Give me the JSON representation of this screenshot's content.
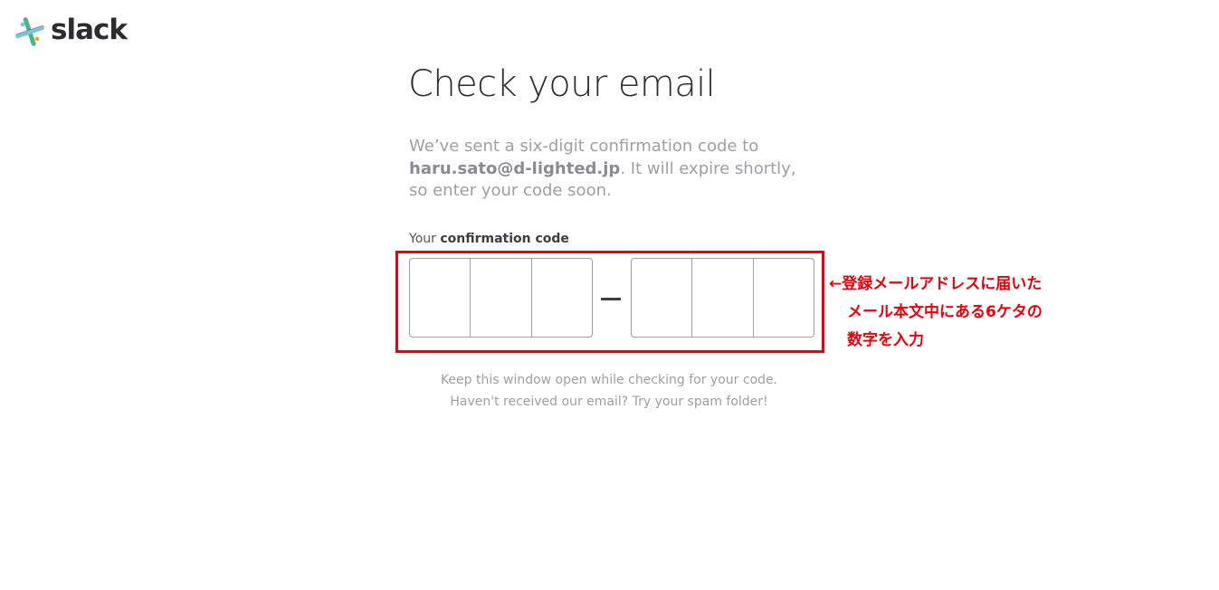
{
  "brand": {
    "name": "slack",
    "colors": {
      "blue": "#70cadb",
      "green": "#3eb890",
      "red": "#e01765",
      "yellow": "#e9a820"
    }
  },
  "page": {
    "title": "Check your email",
    "description": {
      "before_email": "We’ve sent a six-digit confirmation code to ",
      "email": "haru.sato@d-lighted.jp",
      "after_email": ". It will expire shortly, so enter your code soon."
    }
  },
  "code_input": {
    "label_prefix": "Your ",
    "label_bold": "confirmation code",
    "group1": [
      "",
      "",
      ""
    ],
    "group2": [
      "",
      "",
      ""
    ],
    "separator_icon": "dash-icon"
  },
  "annotation": {
    "line1": "←登録メールアドレスに届いた",
    "line2": "メール本文中にある6ケタの",
    "line3": "数字を入力",
    "color": "#e8000b"
  },
  "hint": {
    "line1": "Keep this window open while checking for your code.",
    "line2": "Haven't received our email? Try your spam folder!"
  }
}
